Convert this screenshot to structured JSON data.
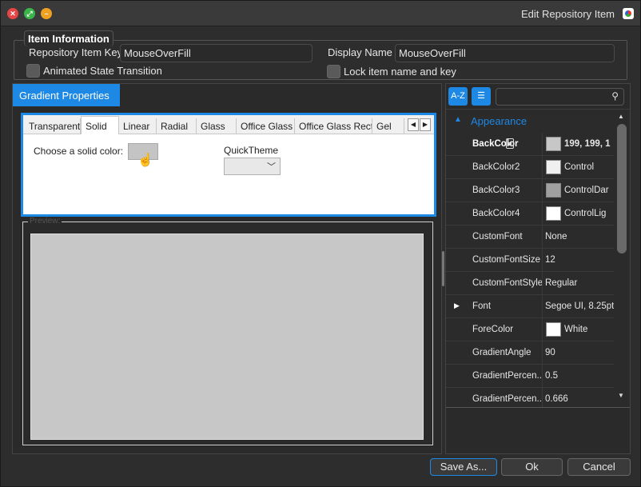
{
  "window": {
    "title": "Edit Repository Item"
  },
  "item_info": {
    "group_title": "Item Information",
    "repo_key_label": "Repository Item Key",
    "repo_key_value": "MouseOverFill",
    "display_name_label": "Display Name :",
    "display_name_value": "MouseOverFill",
    "animated_label": "Animated State Transition",
    "lock_label": "Lock item name and key"
  },
  "gradient": {
    "header": "Gradient Properties",
    "tabs": [
      "Transparent",
      "Solid",
      "Linear",
      "Radial",
      "Glass",
      "Office Glass",
      "Office Glass Rect",
      "Gel"
    ],
    "active_tab": "Solid",
    "choose_color_label": "Choose a solid color:",
    "quicktheme_label": "QuickTheme",
    "preview_label": "Preview:",
    "solid_color": "#c7c7c7"
  },
  "property_grid": {
    "sort_az_label": "A-Z",
    "categorized_icon": "list-icon",
    "category": "Appearance",
    "rows": [
      {
        "name": "BackColor",
        "value": "199, 199, 1",
        "swatch": "#c7c7c7",
        "bold": true,
        "expand": false
      },
      {
        "name": "BackColor2",
        "value": "Control",
        "swatch": "#f0f0f0",
        "bold": false,
        "expand": false
      },
      {
        "name": "BackColor3",
        "value": "ControlDar",
        "swatch": "#a0a0a0",
        "bold": false,
        "expand": false
      },
      {
        "name": "BackColor4",
        "value": "ControlLig",
        "swatch": "#ffffff",
        "bold": false,
        "expand": false
      },
      {
        "name": "CustomFont",
        "value": "None",
        "swatch": null,
        "bold": false,
        "expand": false
      },
      {
        "name": "CustomFontSize",
        "value": "12",
        "swatch": null,
        "bold": false,
        "expand": false
      },
      {
        "name": "CustomFontStyle",
        "value": "Regular",
        "swatch": null,
        "bold": false,
        "expand": false
      },
      {
        "name": "Font",
        "value": "Segoe UI, 8.25pt",
        "swatch": null,
        "bold": false,
        "expand": true
      },
      {
        "name": "ForeColor",
        "value": "White",
        "swatch": "#ffffff",
        "bold": false,
        "expand": false
      },
      {
        "name": "GradientAngle",
        "value": "90",
        "swatch": null,
        "bold": false,
        "expand": false
      },
      {
        "name": "GradientPercen...",
        "value": "0.5",
        "swatch": null,
        "bold": false,
        "expand": false
      },
      {
        "name": "GradientPercen...",
        "value": "0.666",
        "swatch": null,
        "bold": false,
        "expand": false
      }
    ]
  },
  "buttons": {
    "save_as": "Save As...",
    "ok": "Ok",
    "cancel": "Cancel"
  },
  "colors": {
    "accent": "#1e88e5",
    "close": "#e64545",
    "maximize": "#39b54a",
    "minimize": "#f0a020"
  }
}
